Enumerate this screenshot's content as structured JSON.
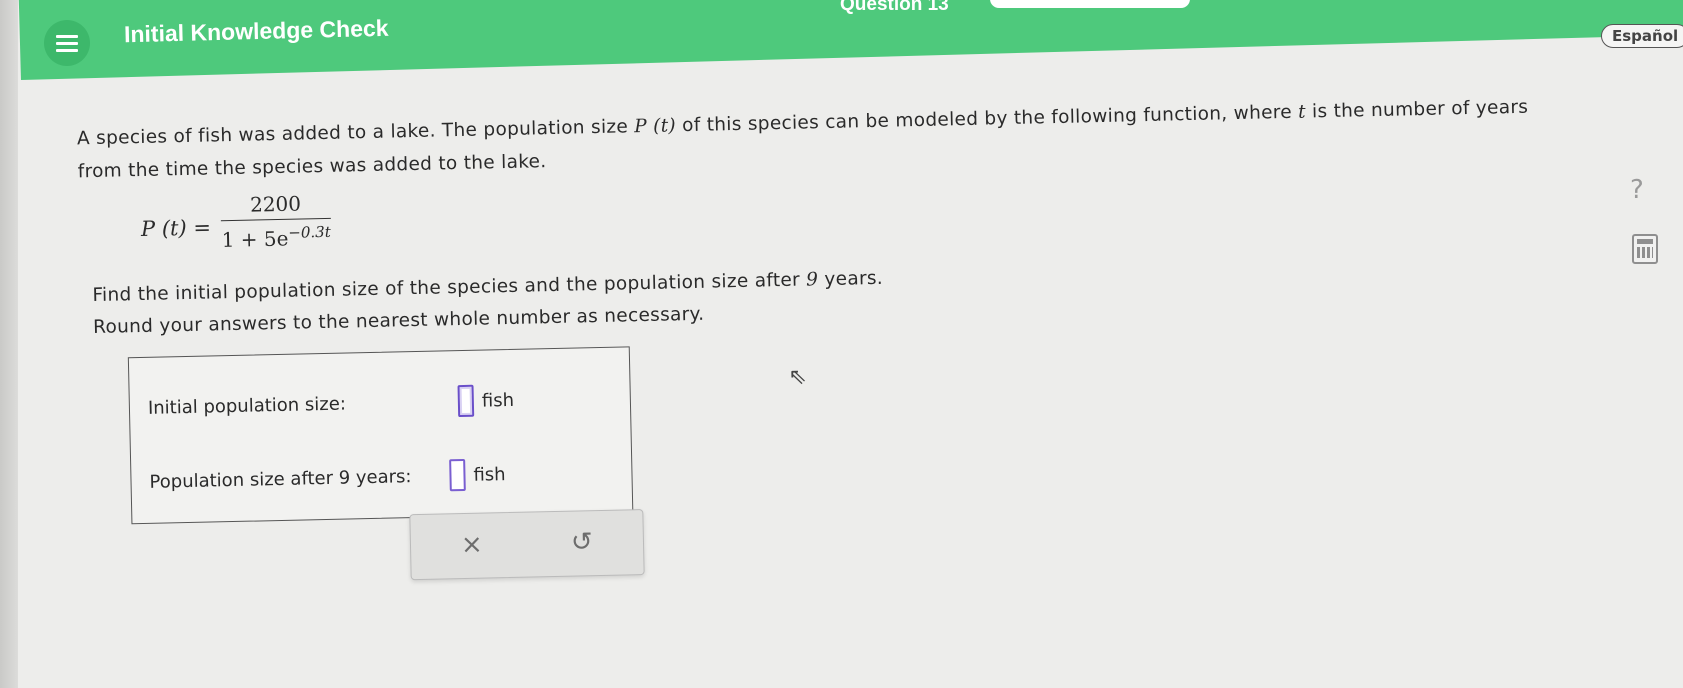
{
  "header": {
    "menu_icon": "hamburger-menu-icon",
    "title": "Initial Knowledge Check",
    "question_label": "Question 13",
    "language_button": "Español",
    "accent_color": "#4ec97c"
  },
  "side_tools": {
    "help_label": "?",
    "help_icon": "question-mark-icon",
    "calculator_icon": "calculator-icon"
  },
  "problem": {
    "intro_part1": "A species of fish was added to a lake. The population size ",
    "function_name": "P (t)",
    "intro_part2": " of this species can be modeled by the following function, where ",
    "variable": "t",
    "intro_part3": " is the number of years from the time the species was added to the lake.",
    "formula": {
      "lhs": "P (t) =",
      "numerator": "2200",
      "denominator_base": "1 + 5e",
      "exponent": "−0.3t"
    },
    "task_part1": "Find the initial population size of the species and the population size after ",
    "task_years": "9",
    "task_part2": " years.",
    "task_line2": "Round your answers to the nearest whole number as necessary."
  },
  "answers": {
    "row1": {
      "label": "Initial population size:",
      "value": "",
      "unit": "fish"
    },
    "row2": {
      "label": "Population size after 9 years:",
      "value": "",
      "unit": "fish"
    }
  },
  "actions": {
    "clear_label": "×",
    "undo_label": "↺"
  }
}
